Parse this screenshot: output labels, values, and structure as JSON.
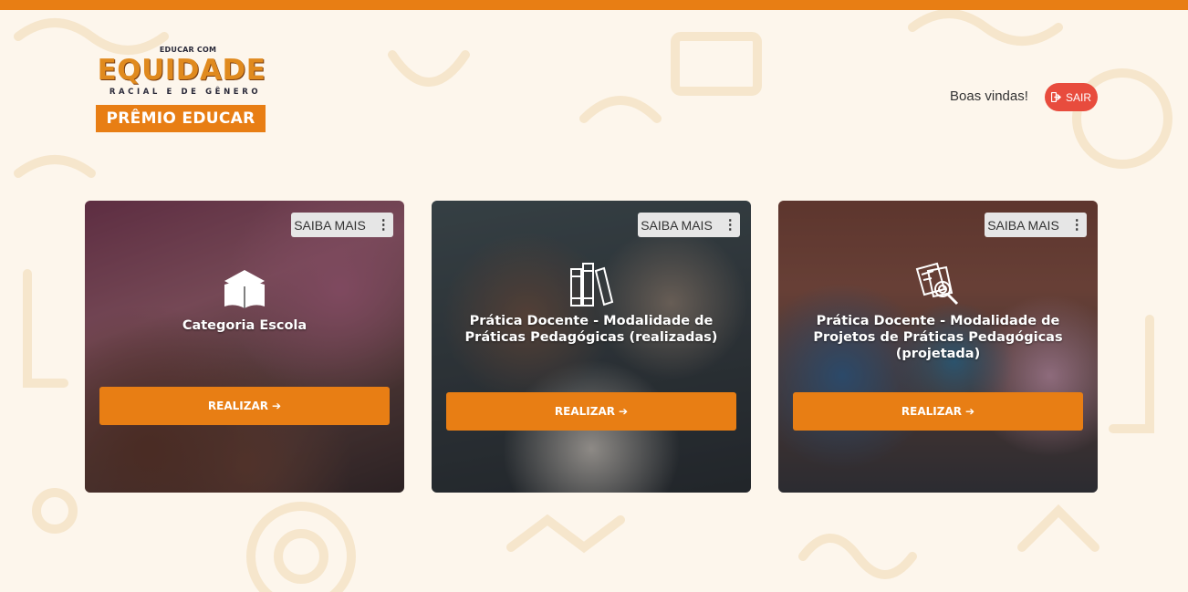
{
  "header": {
    "logo": {
      "pre_title": "EDUCAR COM",
      "title": "EQUIDADE",
      "subtitle": "RACIAL E DE GÊNERO",
      "badge": "PRÊMIO EDUCAR"
    },
    "welcome_text": "Boas vindas!",
    "logout_label": "SAIR"
  },
  "cards": [
    {
      "title": "Categoria Escola",
      "more_label": "SAIBA MAIS",
      "action_label": "REALIZAR",
      "icon": "open-book-icon"
    },
    {
      "title": "Prática Docente - Modalidade de Práticas Pedagógicas (realizadas)",
      "more_label": "SAIBA MAIS",
      "action_label": "REALIZAR",
      "icon": "books-icon"
    },
    {
      "title": "Prática Docente - Modalidade de Projetos de Práticas Pedagógicas (projetada)",
      "more_label": "SAIBA MAIS",
      "action_label": "REALIZAR",
      "icon": "document-search-icon"
    }
  ],
  "colors": {
    "accent": "#e87e14",
    "logout": "#e84c3d",
    "background": "#fdf6ec"
  }
}
